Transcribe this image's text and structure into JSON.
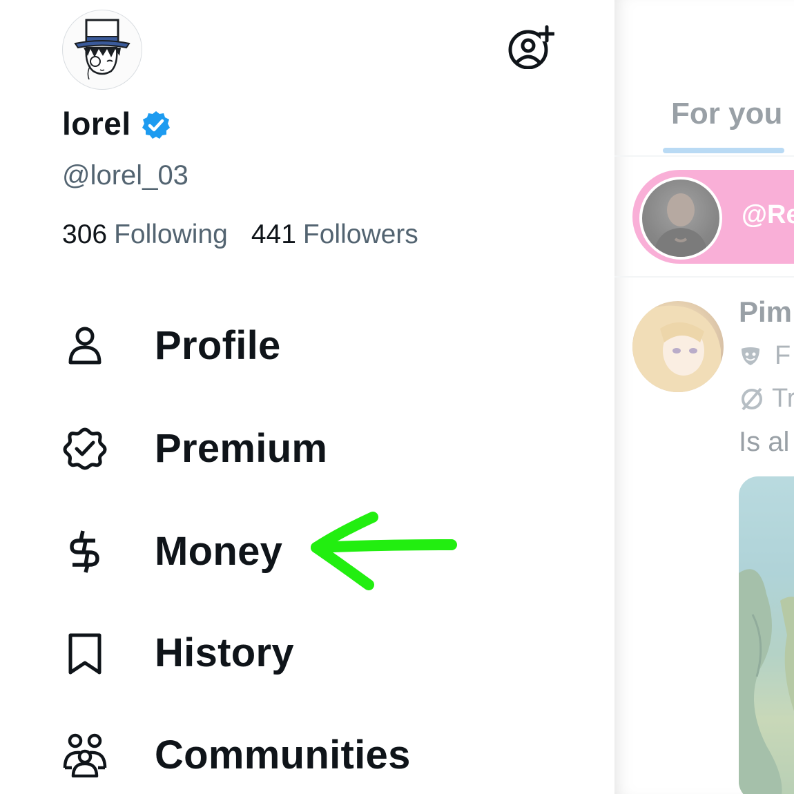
{
  "drawer": {
    "user": {
      "display_name": "lorel",
      "handle": "@lorel_03",
      "verified_color": "#1d9bf0"
    },
    "stats": {
      "following_count": "306",
      "following_label": "Following",
      "followers_count": "441",
      "followers_label": "Followers"
    },
    "nav_items": [
      {
        "label": "Profile",
        "icon": "person-icon"
      },
      {
        "label": "Premium",
        "icon": "premium-badge-icon"
      },
      {
        "label": "Money",
        "icon": "dollar-icon"
      },
      {
        "label": "History",
        "icon": "bookmark-icon"
      },
      {
        "label": "Communities",
        "icon": "communities-icon"
      }
    ],
    "annotation": {
      "color": "#22ee10",
      "icon": "hand-drawn-arrow-icon"
    }
  },
  "timeline": {
    "tab_label": "For you",
    "tab_accent": "#1d9bf0",
    "spaces_handle": "@Re",
    "spaces_color": "#f67fbf",
    "post": {
      "name": "Pim",
      "line2": "F",
      "line3": "Tr",
      "text": "Is al"
    }
  }
}
